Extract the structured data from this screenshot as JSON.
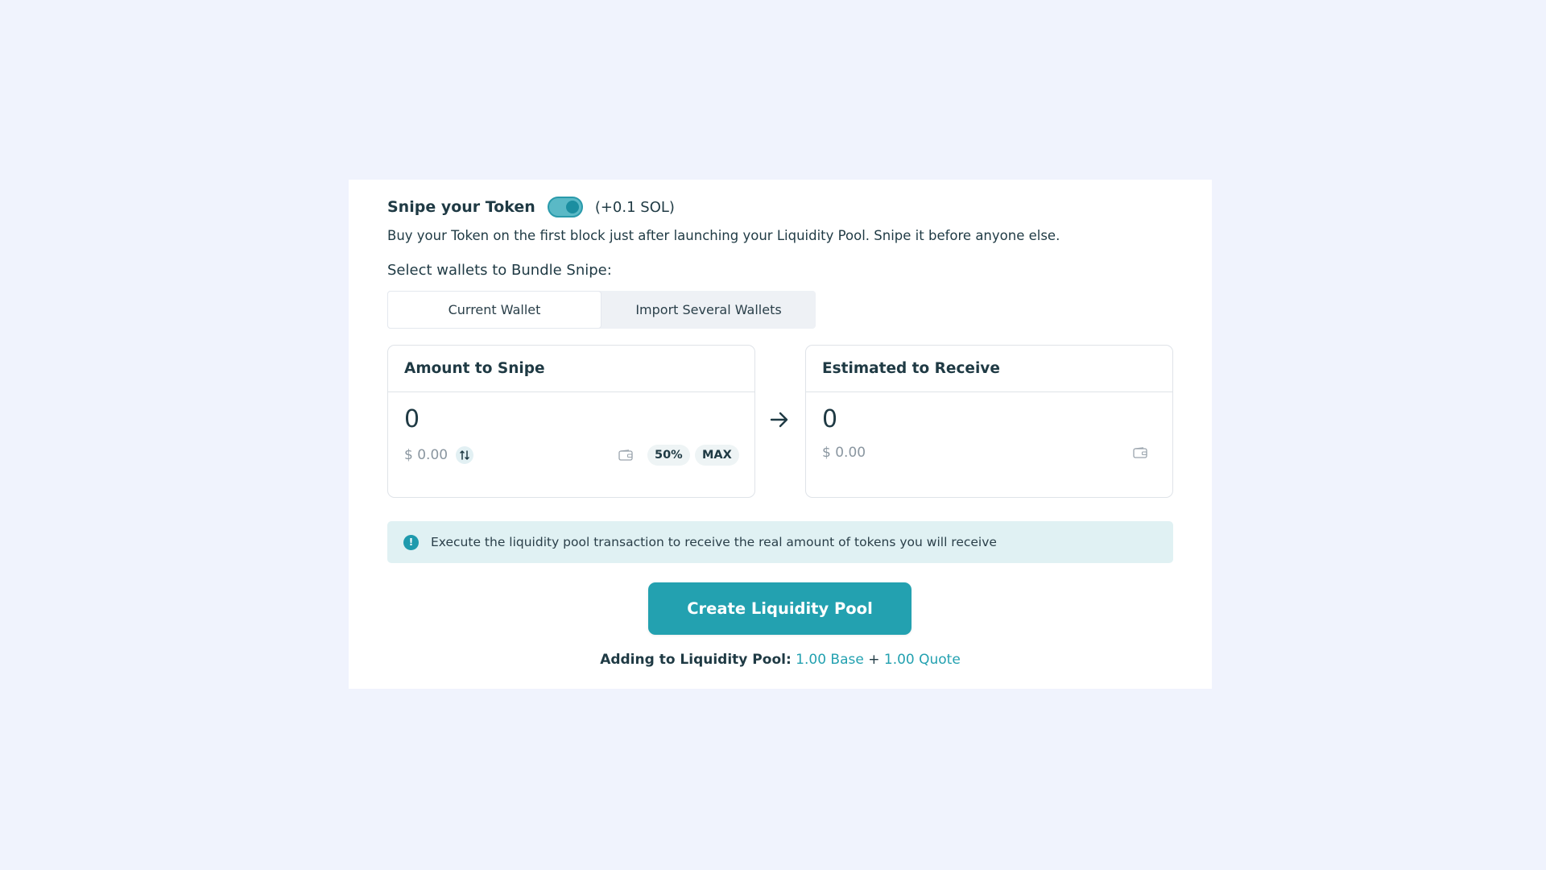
{
  "snipe": {
    "title": "Snipe your Token",
    "toggle_on": true,
    "cost": "(+0.1 SOL)",
    "description": "Buy your Token on the first block just after launching your Liquidity Pool. Snipe it before anyone else."
  },
  "wallets": {
    "label": "Select wallets to Bundle Snipe:",
    "tabs": [
      {
        "label": "Current Wallet",
        "active": true
      },
      {
        "label": "Import Several Wallets",
        "active": false
      }
    ]
  },
  "amount_card": {
    "title": "Amount to Snipe",
    "value": "0",
    "usd": "$ 0.00",
    "pct_button": "50%",
    "max_button": "MAX"
  },
  "receive_card": {
    "title": "Estimated to Receive",
    "value": "0",
    "usd": "$ 0.00"
  },
  "info": {
    "icon": "info-icon",
    "text": "Execute the liquidity pool transaction to receive the real amount of tokens you will receive"
  },
  "action": {
    "button_label": "Create Liquidity Pool"
  },
  "summary": {
    "label": "Adding to Liquidity Pool:",
    "base": "1.00 Base",
    "plus": "+",
    "quote": "1.00 Quote"
  },
  "colors": {
    "accent": "#23a1b0",
    "background": "#f0f3fd",
    "info_bg": "#e0f1f3"
  }
}
